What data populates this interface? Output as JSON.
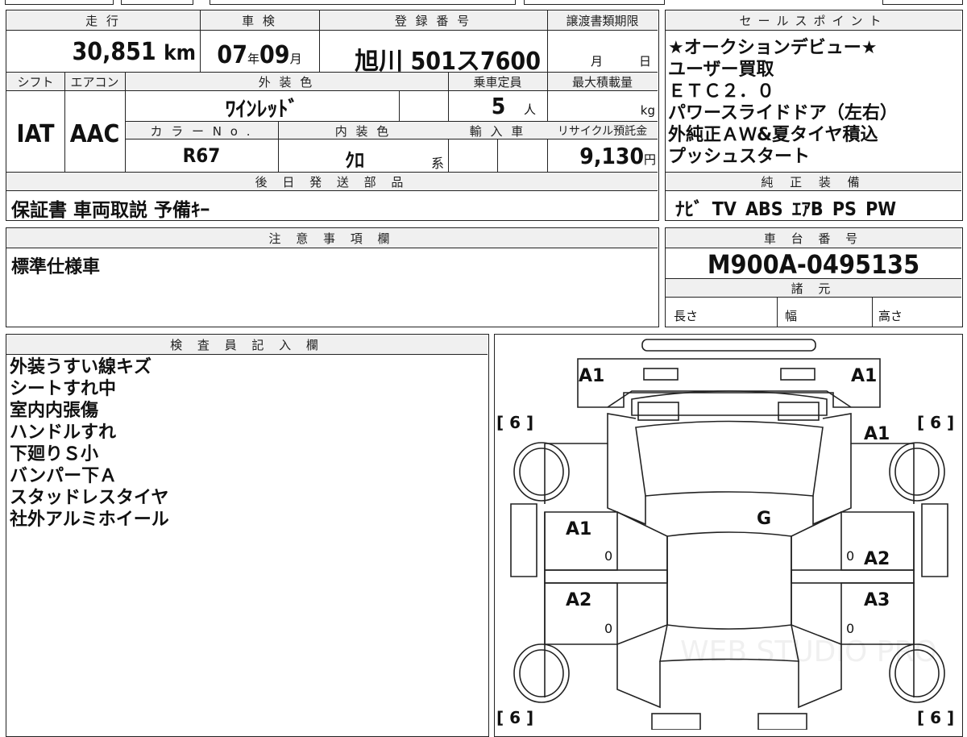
{
  "header": {
    "mileage_label": "走 行",
    "shaken_label": "車 検",
    "reg_label": "登 録 番 号",
    "transfer_label": "譲渡書類期限",
    "sales_label": "セールスポイント",
    "shift_label": "シフト",
    "ac_label": "エアコン",
    "ext_color_label": "外 装 色",
    "capacity_label": "乗車定員",
    "max_load_label": "最大積載量",
    "color_no_label": "カ ラ ー N o .",
    "int_color_label": "内 装 色",
    "import_label": "輸 入 車",
    "recycle_label": "リサイクル預託金",
    "later_parts_label": "後 日 発 送 部 品",
    "genuine_label": "純 正 装 備",
    "caution_label": "注 意 事 項 欄",
    "chassis_label": "車 台 番 号",
    "specs_label": "諸 元",
    "inspector_label": "検 査 員 記 入 欄"
  },
  "vehicle": {
    "mileage": "30,851",
    "mileage_unit": "km",
    "shaken_year": "07",
    "year_unit": "年",
    "shaken_month": "09",
    "month_unit": "月",
    "registration": "旭川 501ス7600",
    "transfer_month": "月",
    "transfer_day": "日",
    "shift": "IAT",
    "ac": "AAC",
    "ext_color": "ﾜｲﾝﾚｯﾄﾞ",
    "capacity": "5",
    "capacity_unit": "人",
    "load_unit": "kg",
    "color_no": "R67",
    "int_color": "ｸﾛ",
    "int_color_suffix": "系",
    "recycle_fee": "9,130",
    "recycle_unit": "円",
    "later_parts": "保証書 車両取説 予備ｷｰ",
    "genuine_equipment": "ﾅﾋﾞ TV ABS ｴｱB PS PW",
    "caution": "標準仕様車",
    "chassis_no": "M900A-0495135",
    "spec_length": "長さ",
    "spec_width": "幅",
    "spec_height": "高さ"
  },
  "sales_points": [
    "★オークションデビュー★",
    "ユーザー買取",
    "ＥＴＣ２．０",
    "パワースライドドア（左右）",
    "外純正ＡＷ&夏タイヤ積込",
    "プッシュスタート"
  ],
  "inspector_notes": [
    "外装うすい線キズ",
    "シートすれ中",
    "室内内張傷",
    "ハンドルすれ",
    "下廻りＳ小",
    "バンパー下Ａ",
    "スタッドレスタイヤ",
    "社外アルミホイール"
  ],
  "diagram": {
    "front_left": "A1",
    "front_right": "A1",
    "tire_tl": "[ 6 ]",
    "tire_tr": "[ 6 ]",
    "tire_bl": "[ 6 ]",
    "tire_br": "[ 6 ]",
    "fender_right": "A1",
    "windshield": "G",
    "door_fl": "A1",
    "door_fr": "A2",
    "door_rl": "A2",
    "door_rr": "A3",
    "door_fl_zero": "0",
    "door_fr_zero": "0",
    "door_rl_zero": "0",
    "door_rr_zero": "0",
    "watermark": "WEB STUDIO PRO"
  }
}
